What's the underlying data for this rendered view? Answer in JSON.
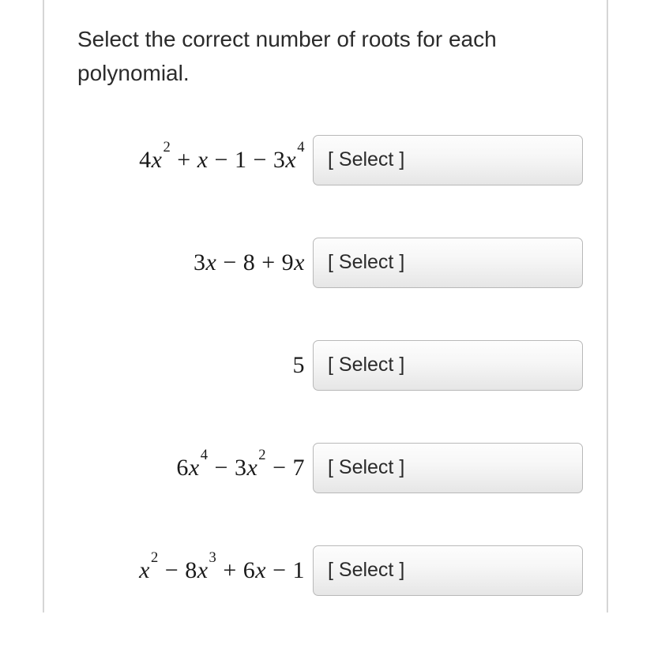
{
  "prompt": "Select the correct number of roots for each polynomial.",
  "select_placeholder": "[ Select ]",
  "rows": [
    {
      "poly_html": "<span class='n'>4</span>x<sup>2</sup> <span class='n'>+</span> x <span class='n'>− 1 − 3</span>x<sup>4</sup>"
    },
    {
      "poly_html": "<span class='n'>3</span>x <span class='n'>− 8 + 9</span>x"
    },
    {
      "poly_html": "<span class='n'>5</span>"
    },
    {
      "poly_html": "<span class='n'>6</span>x<sup>4</sup> <span class='n'>− 3</span>x<sup>2</sup> <span class='n'>− 7</span>"
    },
    {
      "poly_html": "x<sup>2</sup> <span class='n'>− 8</span>x<sup>3</sup> <span class='n'>+ 6</span>x <span class='n'>− 1</span>"
    }
  ]
}
